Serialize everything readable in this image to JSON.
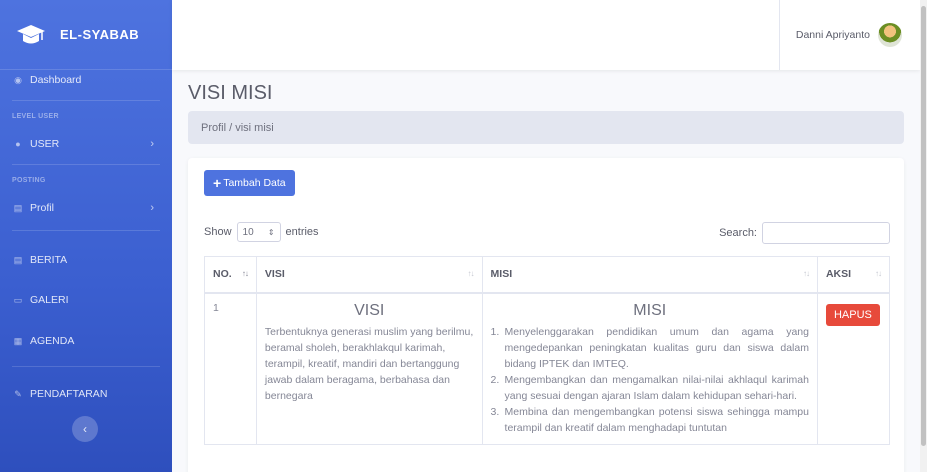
{
  "sidebar": {
    "brand": "EL-SYABAB",
    "items": {
      "dashboard": "Dashboard",
      "level_user_heading": "LEVEL USER",
      "user": "USER",
      "posting_heading": "POSTING",
      "profil": "Profil",
      "berita": "BERITA",
      "galeri": "GALERI",
      "agenda": "AGENDA",
      "pendaftaran": "PENDAFTARAN"
    },
    "toggle_glyph": "‹"
  },
  "topbar": {
    "user_name": "Danni Apriyanto"
  },
  "page": {
    "title": "VISI MISI",
    "breadcrumb": "Profil / visi misi"
  },
  "card": {
    "add_label": "Tambah Data",
    "length": {
      "show": "Show",
      "value": "10",
      "entries": "entries"
    },
    "search_label": "Search:",
    "search_value": "",
    "columns": {
      "no": "NO.",
      "visi": "VISI",
      "misi": "MISI",
      "aksi": "AKSI"
    },
    "row": {
      "no": "1",
      "visi_title": "VISI",
      "visi_text": "Terbentuknya generasi muslim yang berilmu, beramal sholeh, berakhlakqul karimah, terampil, kreatif, mandiri dan bertanggung jawab  dalam beragama, berbahasa dan bernegara",
      "misi_title": "MISI",
      "misi_items": [
        "Menyelenggarakan pendidikan umum dan agama yang mengedepankan peningkatan kualitas guru dan siswa dalam bidang IPTEK dan IMTEQ.",
        "Mengembangkan dan mengamalkan nilai-nilai akhlaqul karimah yang sesuai dengan ajaran Islam dalam kehidupan sehari-hari.",
        "Membina dan mengembangkan potensi siswa sehingga mampu terampil dan kreatif dalam menghadapi tuntutan"
      ],
      "delete_label": "HAPUS"
    }
  },
  "colors": {
    "primary": "#4e73df",
    "danger": "#e74a3b",
    "breadcrumb_bg": "#e3e6f0"
  }
}
